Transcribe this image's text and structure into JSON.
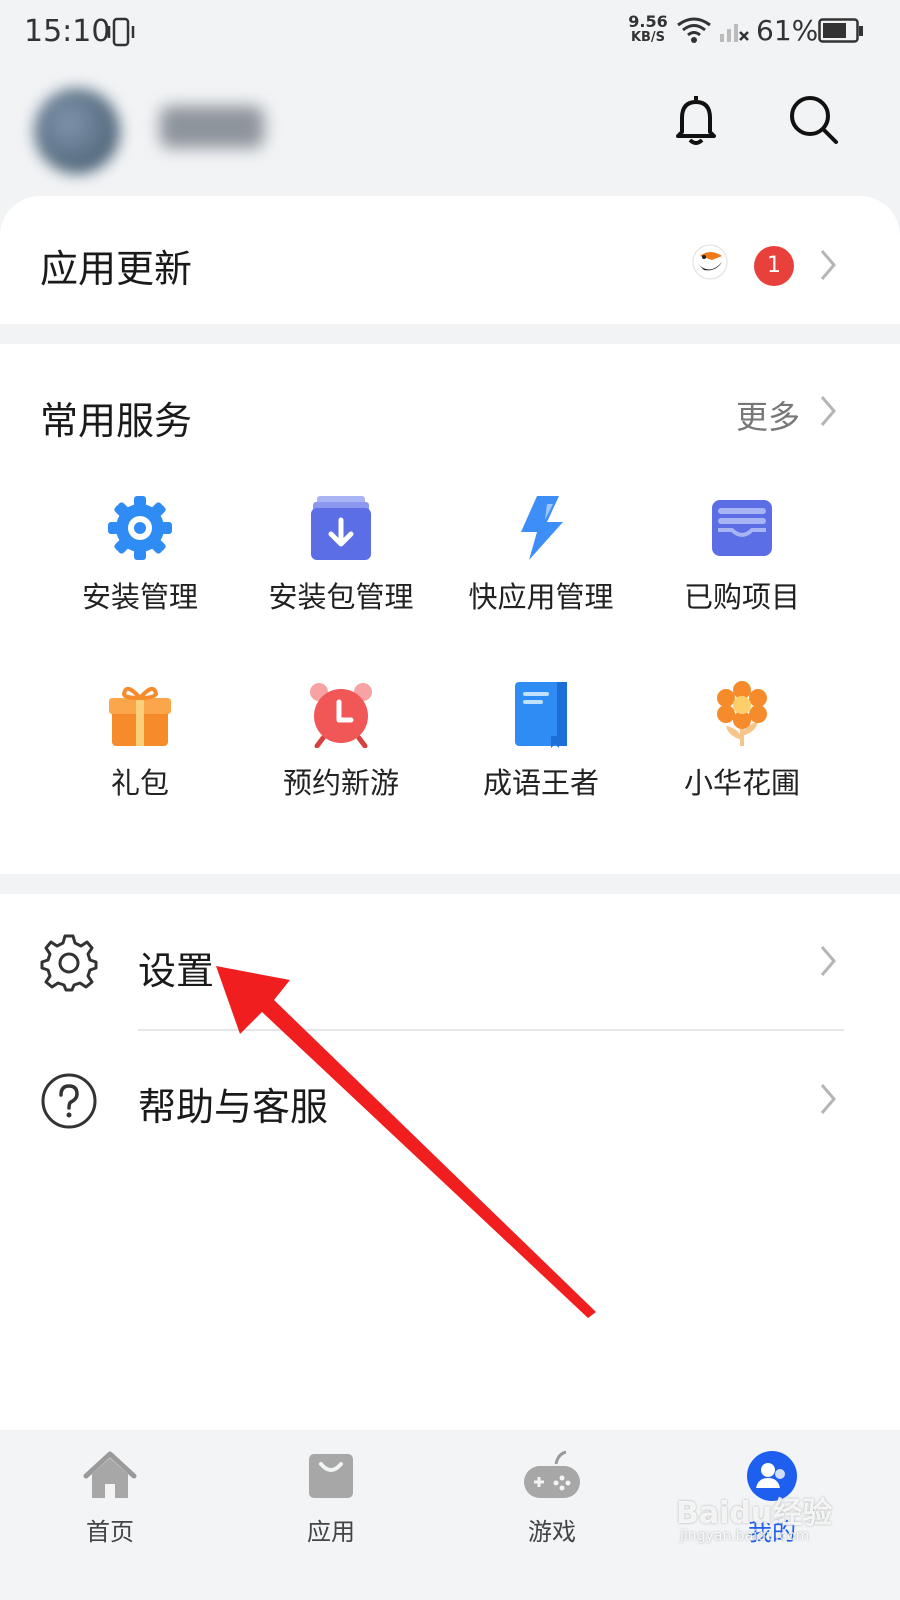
{
  "status_bar": {
    "time": "15:10",
    "net_speed_value": "9.56",
    "net_speed_unit": "KB/S",
    "battery": "61%"
  },
  "header": {
    "icons": [
      "bell-icon",
      "search-icon"
    ]
  },
  "app_update": {
    "title": "应用更新",
    "badge_count": "1",
    "badge_color": "#e8403a"
  },
  "services": {
    "title": "常用服务",
    "more_label": "更多",
    "items": [
      {
        "label": "安装管理",
        "icon": "gear-icon"
      },
      {
        "label": "安装包管理",
        "icon": "package-download-icon"
      },
      {
        "label": "快应用管理",
        "icon": "lightning-icon"
      },
      {
        "label": "已购项目",
        "icon": "wallet-icon"
      },
      {
        "label": "礼包",
        "icon": "gift-icon"
      },
      {
        "label": "预约新游",
        "icon": "alarm-clock-icon"
      },
      {
        "label": "成语王者",
        "icon": "book-icon"
      },
      {
        "label": "小华花圃",
        "icon": "flower-icon"
      }
    ]
  },
  "menu": {
    "settings_label": "设置",
    "help_label": "帮助与客服"
  },
  "bottom_nav": {
    "items": [
      {
        "label": "首页",
        "icon": "home-icon"
      },
      {
        "label": "应用",
        "icon": "bag-icon"
      },
      {
        "label": "游戏",
        "icon": "gamepad-icon"
      },
      {
        "label": "我的",
        "icon": "profile-icon",
        "active": true
      }
    ],
    "active_color": "#1e5ff0"
  },
  "watermark": {
    "text": "Baidu经验",
    "sub": "jingyan.baidu.com"
  }
}
